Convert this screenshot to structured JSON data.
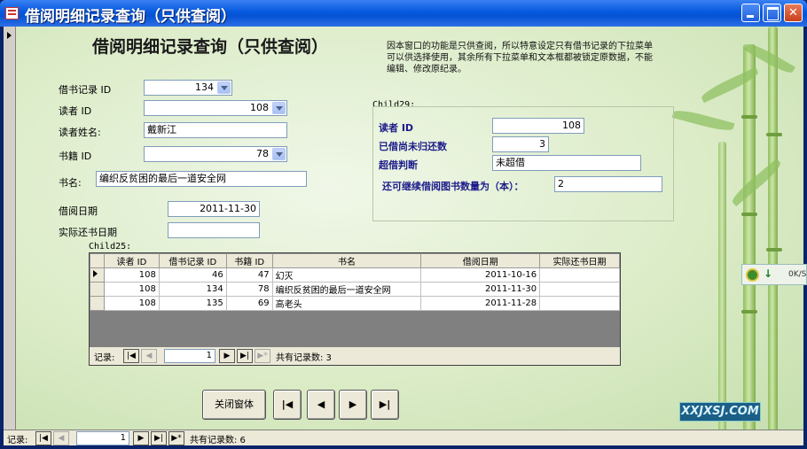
{
  "window": {
    "title": "借阅明细记录查询（只供查阅）"
  },
  "form": {
    "heading": "借阅明细记录查询（只供查阅）",
    "note": "因本窗口的功能是只供查阅，所以特意设定只有借书记录的下拉菜单可以供选择使用，其余所有下拉菜单和文本框都被锁定原数据，不能编辑、修改原纪录。",
    "fields": {
      "borrow_id": {
        "label": "借书记录 ID",
        "value": "134"
      },
      "reader_id": {
        "label": "读者 ID",
        "value": "108"
      },
      "reader_name": {
        "label": "读者姓名:",
        "value": "戴新江"
      },
      "book_id": {
        "label": "书籍 ID",
        "value": "78"
      },
      "book_name": {
        "label": "书名:",
        "value": "编织反贫困的最后一道安全网"
      },
      "borrow_date": {
        "label": "借阅日期",
        "value": "2011-11-30"
      },
      "return_date": {
        "label": "实际还书日期",
        "value": ""
      }
    }
  },
  "child29": {
    "title": "Child29:",
    "reader_id": {
      "label": "读者 ID",
      "value": "108"
    },
    "unreturned": {
      "label": "已借尚未归还数",
      "value": "3"
    },
    "overdue": {
      "label": "超借判断",
      "value": "未超借"
    },
    "remaining": {
      "label": "还可继续借阅图书数量为（本）：",
      "value": "2"
    }
  },
  "child25": {
    "title": "Child25:",
    "columns": [
      "读者 ID",
      "借书记录 ID",
      "书籍 ID",
      "书名",
      "借阅日期",
      "实际还书日期"
    ],
    "rows": [
      [
        "108",
        "46",
        "47",
        "幻灭",
        "2011-10-16",
        ""
      ],
      [
        "108",
        "134",
        "78",
        "编织反贫困的最后一道安全网",
        "2011-11-30",
        ""
      ],
      [
        "108",
        "135",
        "69",
        "高老头",
        "2011-11-28",
        ""
      ]
    ],
    "nav": {
      "label": "记录:",
      "current": "1",
      "total_label": "共有记录数: 3"
    }
  },
  "buttons": {
    "close": "关闭窗体"
  },
  "bottom_nav": {
    "label": "记录:",
    "current": "1",
    "total_label": "共有记录数: 6"
  },
  "watermark": "XXJXSJ.COM",
  "download": {
    "speed": "0K/S"
  }
}
